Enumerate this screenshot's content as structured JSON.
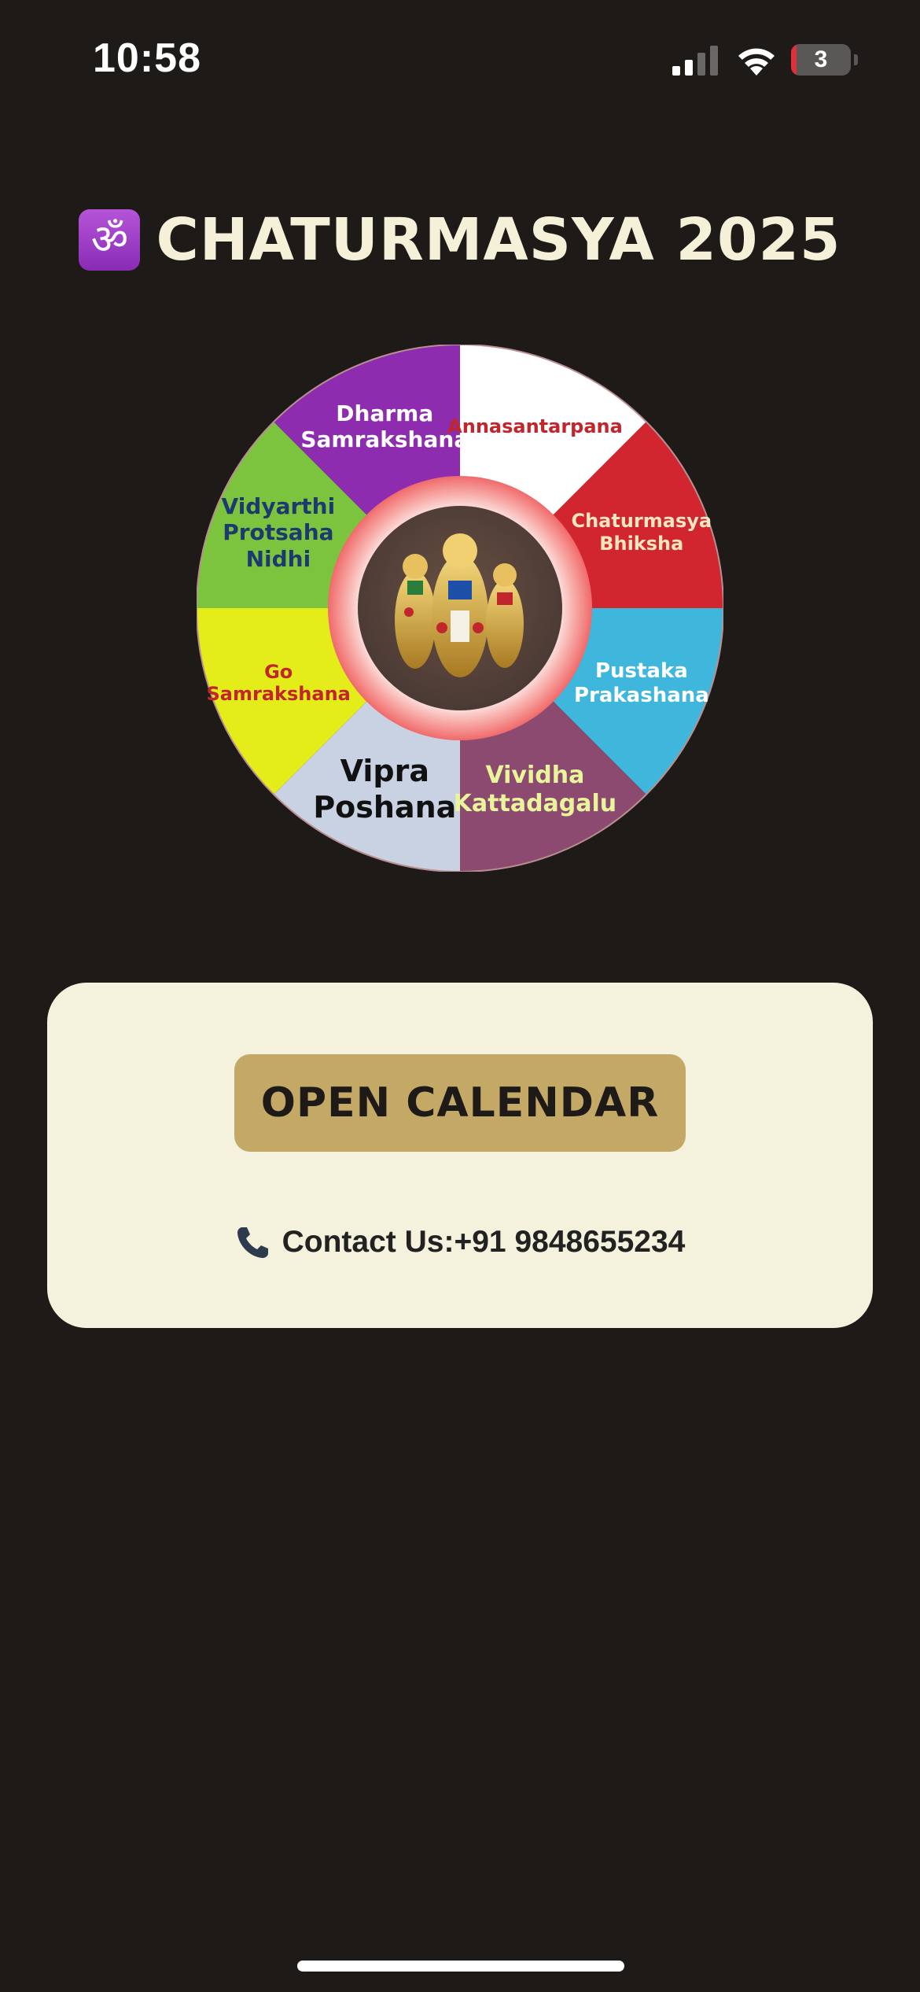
{
  "status_bar": {
    "time": "10:58",
    "battery_level": "3",
    "battery_fraction": 0.03,
    "cellular_bars_active": 2,
    "icons": [
      "signal-icon",
      "wifi-icon",
      "battery-icon"
    ]
  },
  "header": {
    "icon": "om-icon",
    "om_glyph": "ॐ",
    "title": "CHATURMASYA 2025"
  },
  "wheel": {
    "segments": [
      {
        "label": "Annasantarpana",
        "color": "#ffffff",
        "text_color": "#c0262c"
      },
      {
        "label": "Chaturmasya\nBhiksha",
        "color": "#d1262f",
        "text_color": "#f6e6c0"
      },
      {
        "label": "Pustaka\nPrakashana",
        "color": "#3fb7dc",
        "text_color": "#ffffff"
      },
      {
        "label": "Vividha\nKattadagalu",
        "color": "#8c4a70",
        "text_color": "#e9f59a"
      },
      {
        "label": "Vipra\nPoshana",
        "color": "#c8d2e2",
        "text_color": "#111111"
      },
      {
        "label": "Go\nSamrakshana",
        "color": "#e4ec1a",
        "text_color": "#c0262c"
      },
      {
        "label": "Vidyarthi\nProtsaha\nNidhi",
        "color": "#7cc43e",
        "text_color": "#1d3a6e"
      },
      {
        "label": "Dharma\nSamrakshana",
        "color": "#8e2cb0",
        "text_color": "#ffffff"
      }
    ],
    "center_ring_color": "#f8b4b0",
    "center_image": "deity-idols-image"
  },
  "card": {
    "button_label": "OPEN CALENDAR",
    "contact_icon": "phone-icon",
    "contact_text": "Contact Us:+91 9848655234"
  },
  "colors": {
    "background": "#1e1a18",
    "title": "#f5f1d8",
    "card": "#f4f2dc",
    "button": "#c4a865",
    "button_text": "#1e1a18"
  }
}
